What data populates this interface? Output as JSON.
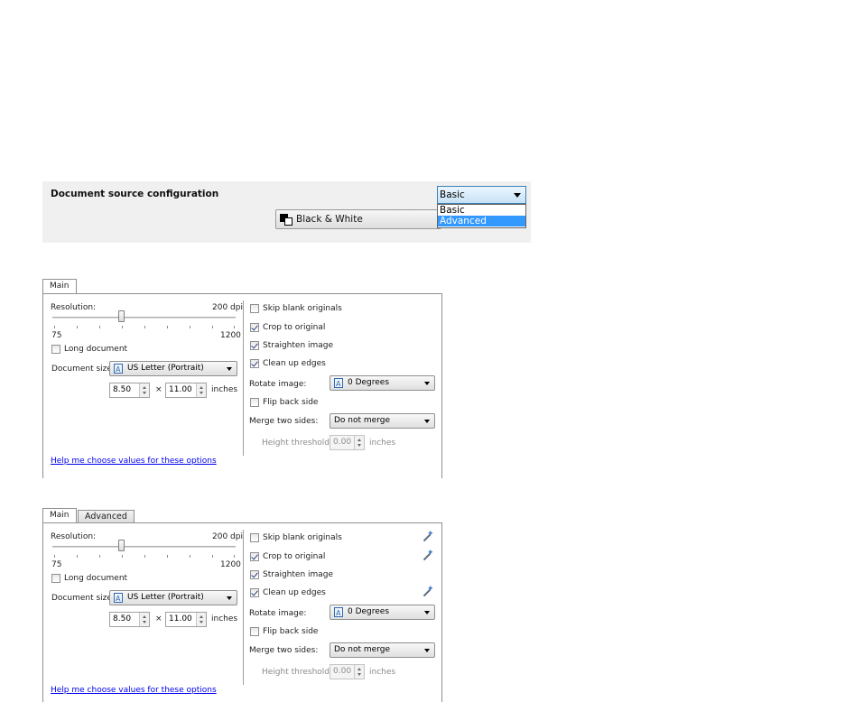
{
  "config_bar": {
    "title": "Document source configuration",
    "color_mode_label": "Black & White",
    "mode_select_value": "Basic",
    "mode_options": [
      "Basic",
      "Advanced"
    ]
  },
  "panel_basic": {
    "tabs": [
      "Main"
    ],
    "resolution_label": "Resolution:",
    "resolution_value": "200 dpi",
    "slider_min": "75",
    "slider_max": "1200",
    "long_document": "Long document",
    "document_size_label": "Document size:",
    "document_size_value": "US Letter (Portrait)",
    "width_value": "8.50",
    "times": "×",
    "height_value": "11.00",
    "units": "inches",
    "skip_blank": "Skip blank originals",
    "crop": "Crop to original",
    "straighten": "Straighten image",
    "clean_edges": "Clean up edges",
    "rotate_label": "Rotate image:",
    "rotate_value": "0 Degrees",
    "flip_back": "Flip back side",
    "merge_label": "Merge two sides:",
    "merge_value": "Do not merge",
    "height_threshold_label": "Height threshold:",
    "height_threshold_value": "0.00",
    "threshold_units": "inches",
    "help_link": "Help me choose values for these options",
    "checks": {
      "skip_blank": false,
      "crop": true,
      "straighten": true,
      "clean_edges": true,
      "flip_back": false,
      "long_document": false
    }
  },
  "panel_advanced": {
    "tabs": [
      "Main",
      "Advanced"
    ],
    "resolution_label": "Resolution:",
    "resolution_value": "200 dpi",
    "slider_min": "75",
    "slider_max": "1200",
    "long_document": "Long document",
    "document_size_label": "Document size:",
    "document_size_value": "US Letter (Portrait)",
    "width_value": "8.50",
    "times": "×",
    "height_value": "11.00",
    "units": "inches",
    "skip_blank": "Skip blank originals",
    "crop": "Crop to original",
    "straighten": "Straighten image",
    "clean_edges": "Clean up edges",
    "rotate_label": "Rotate image:",
    "rotate_value": "0 Degrees",
    "flip_back": "Flip back side",
    "merge_label": "Merge two sides:",
    "merge_value": "Do not merge",
    "height_threshold_label": "Height threshold:",
    "height_threshold_value": "0.00",
    "threshold_units": "inches",
    "help_link": "Help me choose values for these options",
    "icons": [
      "magic-wand-icon"
    ]
  }
}
